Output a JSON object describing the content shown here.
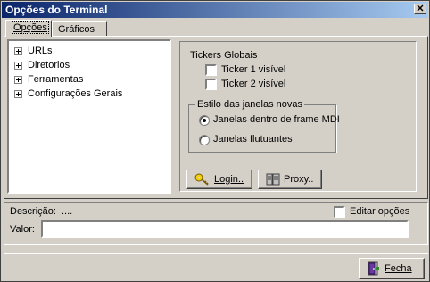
{
  "window": {
    "title": "Opções do Terminal",
    "close_glyph": "✕"
  },
  "tabs": [
    {
      "label": "Opções",
      "active": true
    },
    {
      "label": "Gráficos",
      "active": false
    }
  ],
  "tree": {
    "items": [
      {
        "label": "URLs"
      },
      {
        "label": "Diretorios"
      },
      {
        "label": "Ferramentas"
      },
      {
        "label": "Configurações Gerais"
      }
    ]
  },
  "tickers": {
    "title": "Tickers Globais",
    "ticker1": {
      "label": "Ticker 1 visível",
      "checked": false
    },
    "ticker2": {
      "label": "Ticker 2 visível",
      "checked": false
    }
  },
  "window_style": {
    "title": "Estilo das janelas novas",
    "options": [
      {
        "label": "Janelas dentro de frame MDI",
        "selected": true
      },
      {
        "label": "Janelas flutuantes",
        "selected": false
      }
    ]
  },
  "buttons": {
    "login": {
      "label": "Login..",
      "icon": "key-icon"
    },
    "proxy": {
      "label": "Proxy..",
      "icon": "proxy-server-icon"
    },
    "fecha": {
      "label": "Fecha",
      "icon": "door-exit-icon"
    }
  },
  "description": {
    "label": "Descrição:",
    "value": "...."
  },
  "edit_options": {
    "label": "Editar opções",
    "checked": false
  },
  "valor": {
    "label": "Valor:",
    "value": ""
  }
}
